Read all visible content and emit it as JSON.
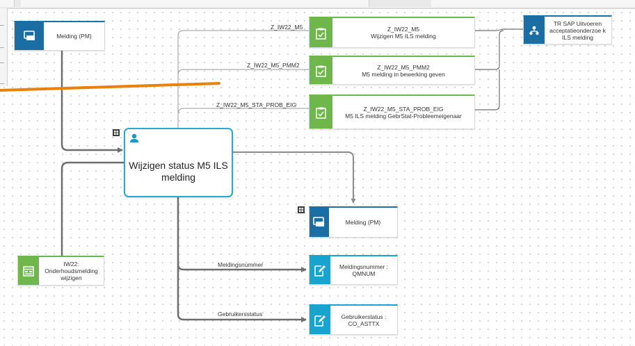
{
  "colors": {
    "blue_band": "#1a6ea3",
    "green_band": "#6fb74a",
    "cyan_band": "#18a4cf",
    "main_border": "#27a7d2",
    "annotation_line": "#e8820c",
    "connector": "#6e6e6e"
  },
  "icons": {
    "process_node": "person-icon",
    "melding": "monitor-icon",
    "transaction": "clipboard-check-icon",
    "field": "edit-form-icon",
    "screen": "window-icon",
    "role": "org-chart-icon",
    "sub": "structure-icon"
  },
  "nodes": {
    "melding_top": {
      "text": "Melding (PM)"
    },
    "main_process": {
      "text": "Wijzigen status M5 ILS melding"
    },
    "tr1": {
      "text": "Z_IW22_M5\nWijzigen M5 ILS melding"
    },
    "tr2": {
      "text": "Z_IW22_M5_PMM2\nM5 melding in bewerking geven"
    },
    "tr3": {
      "text": "Z_IW22_M5_STA_PROB_EIG\nM5 ILS melding GebrStat-Probleemeigenaar"
    },
    "role": {
      "text": "TR SAP Uitvoeren acceptatieonderzoe k ILS melding"
    },
    "melding_bottom": {
      "text": "Melding (PM)"
    },
    "iw22": {
      "text": "IW22:\nOnderhoudsmelding wijzigen"
    },
    "field1": {
      "text": "Meldingsnummer :\nQMNUM"
    },
    "field2": {
      "text": "Gebruikerstatus :\nCO_ASTTX"
    }
  },
  "edge_labels": {
    "e1": "Z_IW22_M5",
    "e2": "Z_IW22_M5_PMM2",
    "e3": "Z_IW22_M5_STA_PROB_EIG",
    "e4": "Meldingsnummer",
    "e5": "Gebruikersstatus"
  }
}
